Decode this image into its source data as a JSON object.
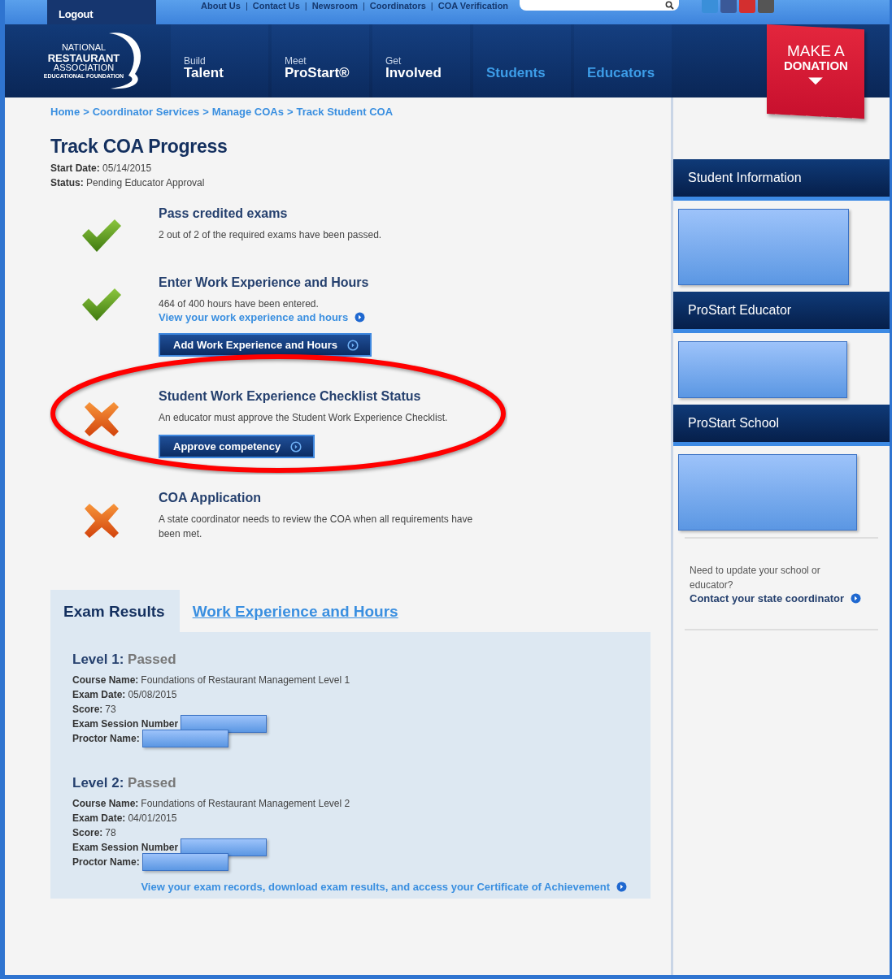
{
  "top_bar": {
    "logout": "Logout",
    "links": [
      "About Us",
      "Contact Us",
      "Newsroom",
      "Coordinators",
      "COA Verification"
    ],
    "separator": "|"
  },
  "logo": {
    "lines": [
      "NATIONAL",
      "RESTAURANT",
      "ASSOCIATION",
      "EDUCATIONAL FOUNDATION"
    ]
  },
  "nav": [
    {
      "small": "Build",
      "label": "Talent"
    },
    {
      "small": "Meet",
      "label": "ProStart®"
    },
    {
      "small": "Get",
      "label": "Involved"
    },
    {
      "label": "Students"
    },
    {
      "label": "Educators"
    }
  ],
  "donation": {
    "lines": [
      "MAKE A",
      "DONATION"
    ]
  },
  "breadcrumb": [
    "Home",
    "Coordinator Services",
    "Manage COAs",
    "Track Student COA"
  ],
  "breadcrumb_separator": ">",
  "title": "Track COA Progress",
  "meta": [
    {
      "label": "Start Date:",
      "value": "05/14/2015"
    },
    {
      "label": "Status:",
      "value": "Pending Educator Approval"
    }
  ],
  "steps": [
    {
      "kind": "done",
      "title": "Pass credited exams",
      "text": "2 out of 2 of the required exams have been passed."
    },
    {
      "kind": "done",
      "title": "Enter Work Experience and Hours",
      "text": "464 of 400 hours have been entered.",
      "link": "View your work experience and hours",
      "button": "Add Work Experience and Hours"
    },
    {
      "kind": "pending",
      "title": "Student Work Experience Checklist Status",
      "text": "An educator must approve the Student Work Experience Checklist.",
      "button": "Approve competency",
      "circled": true
    },
    {
      "kind": "pending",
      "title": "COA Application",
      "text": "A state coordinator needs to review the COA when all requirements have been met."
    }
  ],
  "tabs": [
    {
      "label": "Exam Results",
      "selected": true
    },
    {
      "label": "Work Experience and Hours",
      "selected": false
    }
  ],
  "levels": [
    {
      "name": "Level 1:",
      "result": "Passed",
      "fields": [
        {
          "label": "Course Name:",
          "value": "Foundations of Restaurant Management Level 1"
        },
        {
          "label": "Exam Date:",
          "value": "05/08/2015"
        },
        {
          "label": "Score:",
          "value": "73"
        },
        {
          "label": "Exam Session Number",
          "redacted": true
        },
        {
          "label": "Proctor Name:",
          "redacted": true
        }
      ]
    },
    {
      "name": "Level 2:",
      "result": "Passed",
      "fields": [
        {
          "label": "Course Name:",
          "value": "Foundations of Restaurant Management Level 2"
        },
        {
          "label": "Exam Date:",
          "value": "04/01/2015"
        },
        {
          "label": "Score:",
          "value": "78"
        },
        {
          "label": "Exam Session Number",
          "redacted": true
        },
        {
          "label": "Proctor Name:",
          "redacted": true
        }
      ]
    }
  ],
  "exam_link": "View your exam records, download exam results, and access your Certificate of Achievement",
  "sidebar": {
    "sections": [
      {
        "title": "Student Information"
      },
      {
        "title": "ProStart Educator"
      },
      {
        "title": "ProStart School"
      }
    ],
    "note": "Need to update your school or educator?",
    "link": "Contact your state coordinator"
  }
}
